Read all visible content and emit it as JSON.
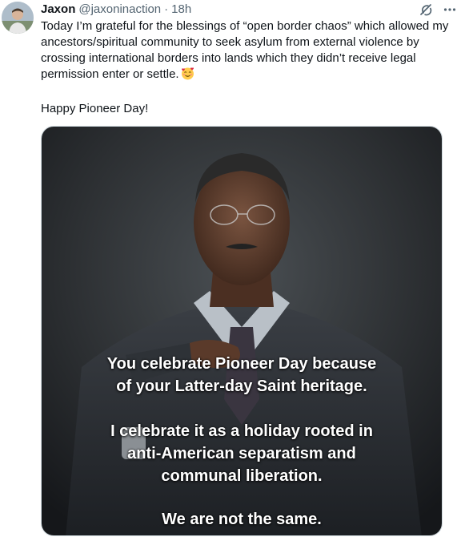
{
  "tweet": {
    "author": {
      "display_name": "Jaxon",
      "handle": "@jaxoninaction",
      "separator": "·",
      "time": "18h"
    },
    "icons": {
      "grok": "grok-icon",
      "more": "more-icon",
      "emoji": "smiling-face-with-hearts-emoji"
    },
    "text": {
      "paragraph1": "Today I’m grateful for the blessings of “open border chaos” which allowed my ancestors/spiritual community to seek asylum from external violence by crossing international borders into lands which they didn’t receive legal permission enter or settle.",
      "paragraph2": "Happy Pioneer Day!"
    },
    "media": {
      "caption_1_line1": "You celebrate Pioneer Day because",
      "caption_1_line2": "of your Latter-day Saint heritage.",
      "caption_2_line1": "I celebrate it as a holiday rooted in",
      "caption_2_line2": "anti-American separatism and",
      "caption_2_line3": "communal liberation.",
      "caption_3": "We are not the same."
    }
  }
}
